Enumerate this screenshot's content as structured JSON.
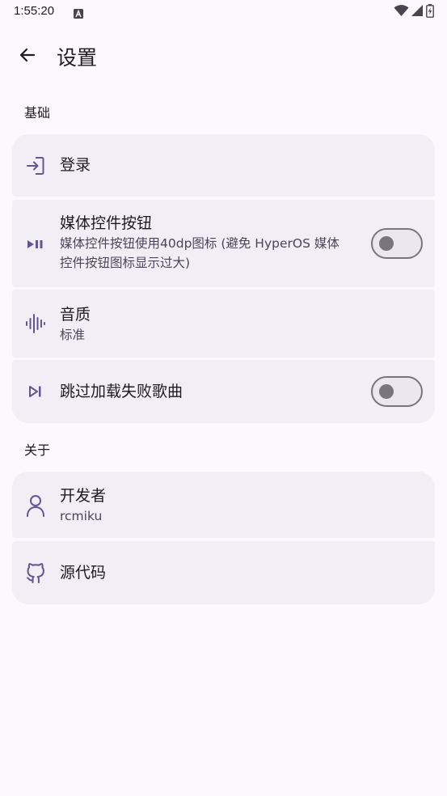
{
  "status_bar": {
    "time": "1:55:20",
    "notification_icon": "font-a-icon",
    "icons": [
      "wifi-icon",
      "signal-icon",
      "battery-icon"
    ]
  },
  "app_bar": {
    "back_icon": "arrow-back-icon",
    "title": "设置"
  },
  "sections": {
    "basic": {
      "header": "基础",
      "login": {
        "title": "登录",
        "icon": "login-icon"
      },
      "media_buttons": {
        "title": "媒体控件按钮",
        "subtitle_line1": "媒体控件按钮使用40dp图标 (避免 HyperOS 媒体",
        "subtitle_line2": "控件按钮图标显示过大)",
        "icon": "play-pause-icon",
        "switch_on": false
      },
      "audio_quality": {
        "title": "音质",
        "subtitle": "标准",
        "icon": "waveform-icon"
      },
      "skip_failed": {
        "title": "跳过加载失败歌曲",
        "icon": "skip-next-icon",
        "switch_on": false
      }
    },
    "about": {
      "header": "关于",
      "developer": {
        "title": "开发者",
        "subtitle": "rcmiku",
        "icon": "person-icon"
      },
      "source_code": {
        "title": "源代码",
        "icon": "github-icon"
      }
    }
  },
  "colors": {
    "background": "#fdf7fe",
    "surface": "#f2eef6",
    "icon_accent": "#65558f",
    "text_primary": "#1d1b20",
    "text_secondary": "#4a4458",
    "switch_outline": "#79747e"
  }
}
